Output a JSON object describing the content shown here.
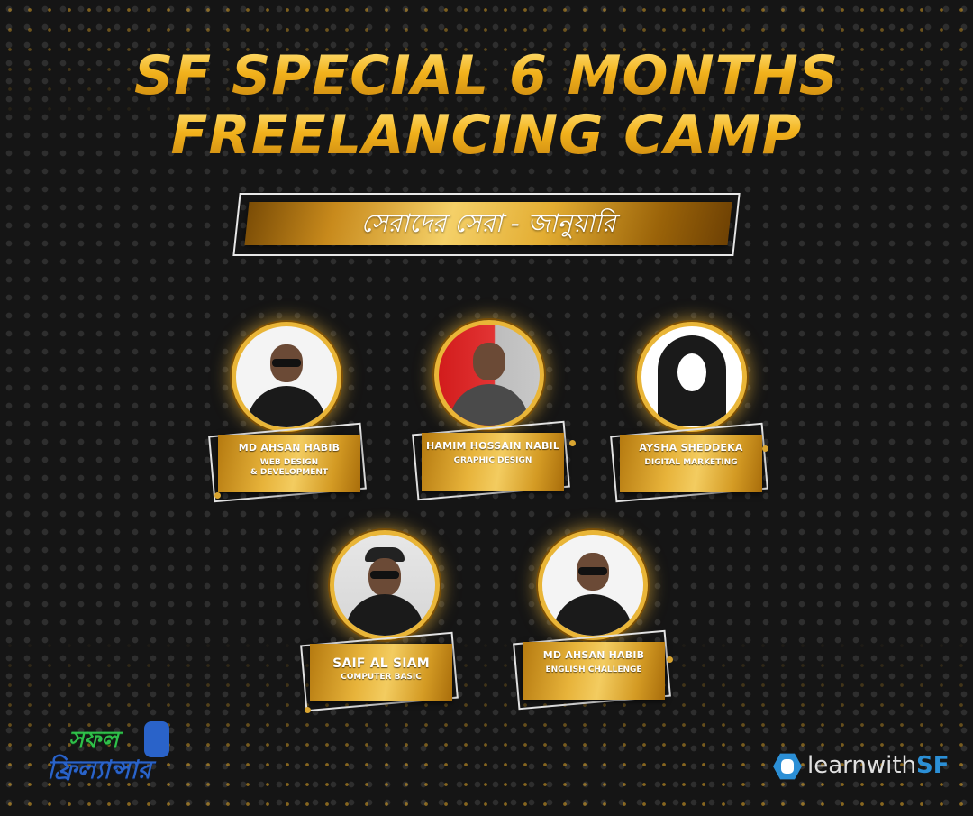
{
  "title": {
    "line1": "SF SPECIAL 6 MONTHS",
    "line2": "FREELANCING CAMP"
  },
  "ribbon_text": "সেরাদের সেরা - জানুয়ারি",
  "winners": [
    {
      "name": "MD AHSAN HABIB",
      "role": "WEB DESIGN\n& DEVELOPMENT"
    },
    {
      "name": "HAMIM HOSSAIN NABIL",
      "role": "GRAPHIC DESIGN"
    },
    {
      "name": "AYSHA SHEDDEKA",
      "role": "DIGITAL MARKETING"
    },
    {
      "name": "SAIF AL SIAM",
      "role": "COMPUTER BASIC"
    },
    {
      "name": "MD AHSAN HABIB",
      "role": "ENGLISH CHALLENGE"
    }
  ],
  "logos": {
    "left_line1": "সফল",
    "left_line2": "ফ্রিল্যান্সার",
    "right_prefix": "learnwith",
    "right_suffix": "SF"
  },
  "colors": {
    "gold": "#f0b323",
    "background": "#151515",
    "brand_blue": "#2b8fd6",
    "brand_green": "#2fc04a"
  }
}
